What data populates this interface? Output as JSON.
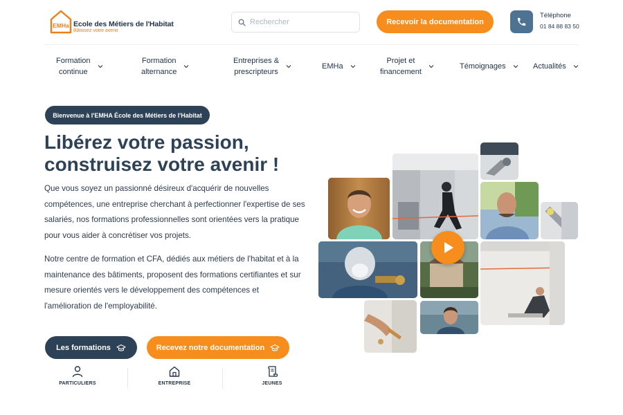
{
  "header": {
    "logo_mark": "EMHa",
    "logo_name": "Ecole des Métiers de l'Habitat",
    "logo_tagline": "Bâtissez votre avenir",
    "search_placeholder": "Rechercher",
    "doc_button": "Recevoir la documentation",
    "phone_label": "Téléphone",
    "phone_number": "01 84 88 83 50"
  },
  "nav": {
    "items": [
      {
        "label": "Formation\ncontinue"
      },
      {
        "label": "Formation\nalternance"
      },
      {
        "label": "Entreprises &\nprescripteurs"
      },
      {
        "label": "EMHa"
      },
      {
        "label": "Projet et\nfinancement"
      },
      {
        "label": "Témoignages"
      },
      {
        "label": "Actualités"
      }
    ]
  },
  "hero": {
    "welcome": "Bienvenue à l'EMHA École des Métiers de l'Habitat",
    "title_line1": "Libérez votre passion,",
    "title_line2": "construisez votre avenir !",
    "paragraph1": "Que vous soyez un passionné désireux d'acquérir de nouvelles compétences, une entreprise cherchant à perfectionner l'expertise de ses salariés, nos formations professionnelles sont orientées vers la pratique pour vous aider à concrétiser vos projets.",
    "paragraph2": "Notre centre de formation et CFA, dédiés aux métiers de l'habitat et à la maintenance des bâtiments, proposent des formations certifiantes et sur mesure orientés vers le développement des compétences et l'amélioration de l'employabilité.",
    "btn_formations": "Les formations",
    "btn_documentation": "Recevez notre documentation"
  },
  "audience": {
    "particuliers": "PARTICULIERS",
    "entreprise": "ENTREPRISE",
    "jeunes": "JEUNES"
  },
  "colors": {
    "navy": "#2d4157",
    "orange": "#f78d1d",
    "phone_box": "#4e7392"
  },
  "icons": [
    "house-logo-icon",
    "search-icon",
    "phone-icon",
    "chevron-down-icon",
    "graduation-cap-icon",
    "person-icon",
    "home-icon",
    "scroll-icon",
    "play-icon"
  ]
}
